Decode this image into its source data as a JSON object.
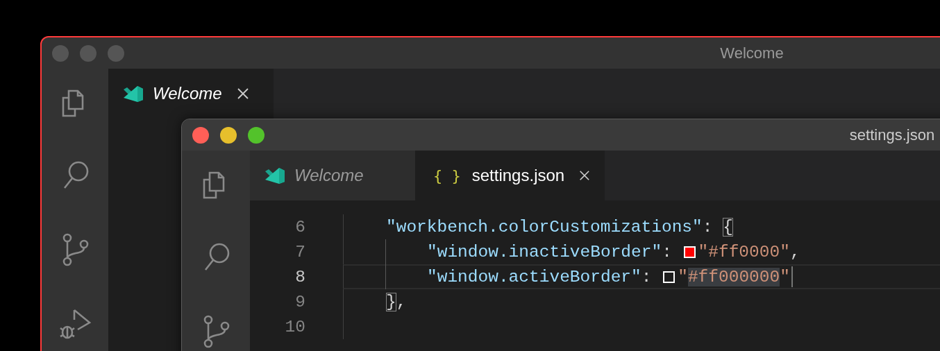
{
  "windows": [
    {
      "title": "Welcome",
      "active": false,
      "color": "#ff3b3b",
      "activity": [
        {
          "kind": "files"
        },
        {
          "kind": "search"
        },
        {
          "kind": "branch"
        },
        {
          "kind": "debug"
        }
      ],
      "tabs": [
        {
          "label": "Welcome",
          "kind": "welcome",
          "preview": true,
          "selected": true,
          "closable": true
        }
      ]
    },
    {
      "title": "settings.json",
      "active": true,
      "color": "#5c5c5c",
      "activity": [
        {
          "kind": "files"
        },
        {
          "kind": "search"
        },
        {
          "kind": "branch"
        }
      ],
      "tabs": [
        {
          "label": "Welcome",
          "kind": "welcome",
          "preview": true,
          "selected": false,
          "closable": false
        },
        {
          "label": "settings.json",
          "kind": "json",
          "icon_text": "{ }",
          "preview": false,
          "selected": true,
          "closable": true
        }
      ],
      "editor": {
        "lines": [
          {
            "number": "6",
            "kind": "top",
            "current": false,
            "tokens": [
              {
                "kind": "key",
                "text": "\"workbench.colorCustomizations\""
              },
              {
                "kind": "punct",
                "text": ": "
              },
              {
                "kind": "bracket-match",
                "text": "{"
              }
            ]
          },
          {
            "number": "7",
            "kind": "nested",
            "current": false,
            "tokens": [
              {
                "kind": "key",
                "text": "\"window.inactiveBorder\""
              },
              {
                "kind": "punct",
                "text": ": "
              },
              {
                "kind": "swatch",
                "color": "#ff0000",
                "filled": true
              },
              {
                "kind": "string",
                "text": "\"#ff0000\""
              },
              {
                "kind": "punct",
                "text": ","
              }
            ]
          },
          {
            "number": "8",
            "kind": "nested",
            "current": true,
            "tokens": [
              {
                "kind": "key",
                "text": "\"window.activeBorder\""
              },
              {
                "kind": "punct",
                "text": ": "
              },
              {
                "kind": "swatch",
                "color": "#ffffff",
                "filled": false
              },
              {
                "kind": "string",
                "text": "\""
              },
              {
                "kind": "selection",
                "text": "#ff000000"
              },
              {
                "kind": "string",
                "text": "\""
              },
              {
                "kind": "cursor"
              }
            ]
          },
          {
            "number": "9",
            "kind": "top",
            "current": false,
            "tokens": [
              {
                "kind": "bracket-match",
                "text": "}"
              },
              {
                "kind": "punct",
                "text": ","
              }
            ]
          },
          {
            "number": "10",
            "kind": "top",
            "current": false
          }
        ]
      }
    }
  ]
}
